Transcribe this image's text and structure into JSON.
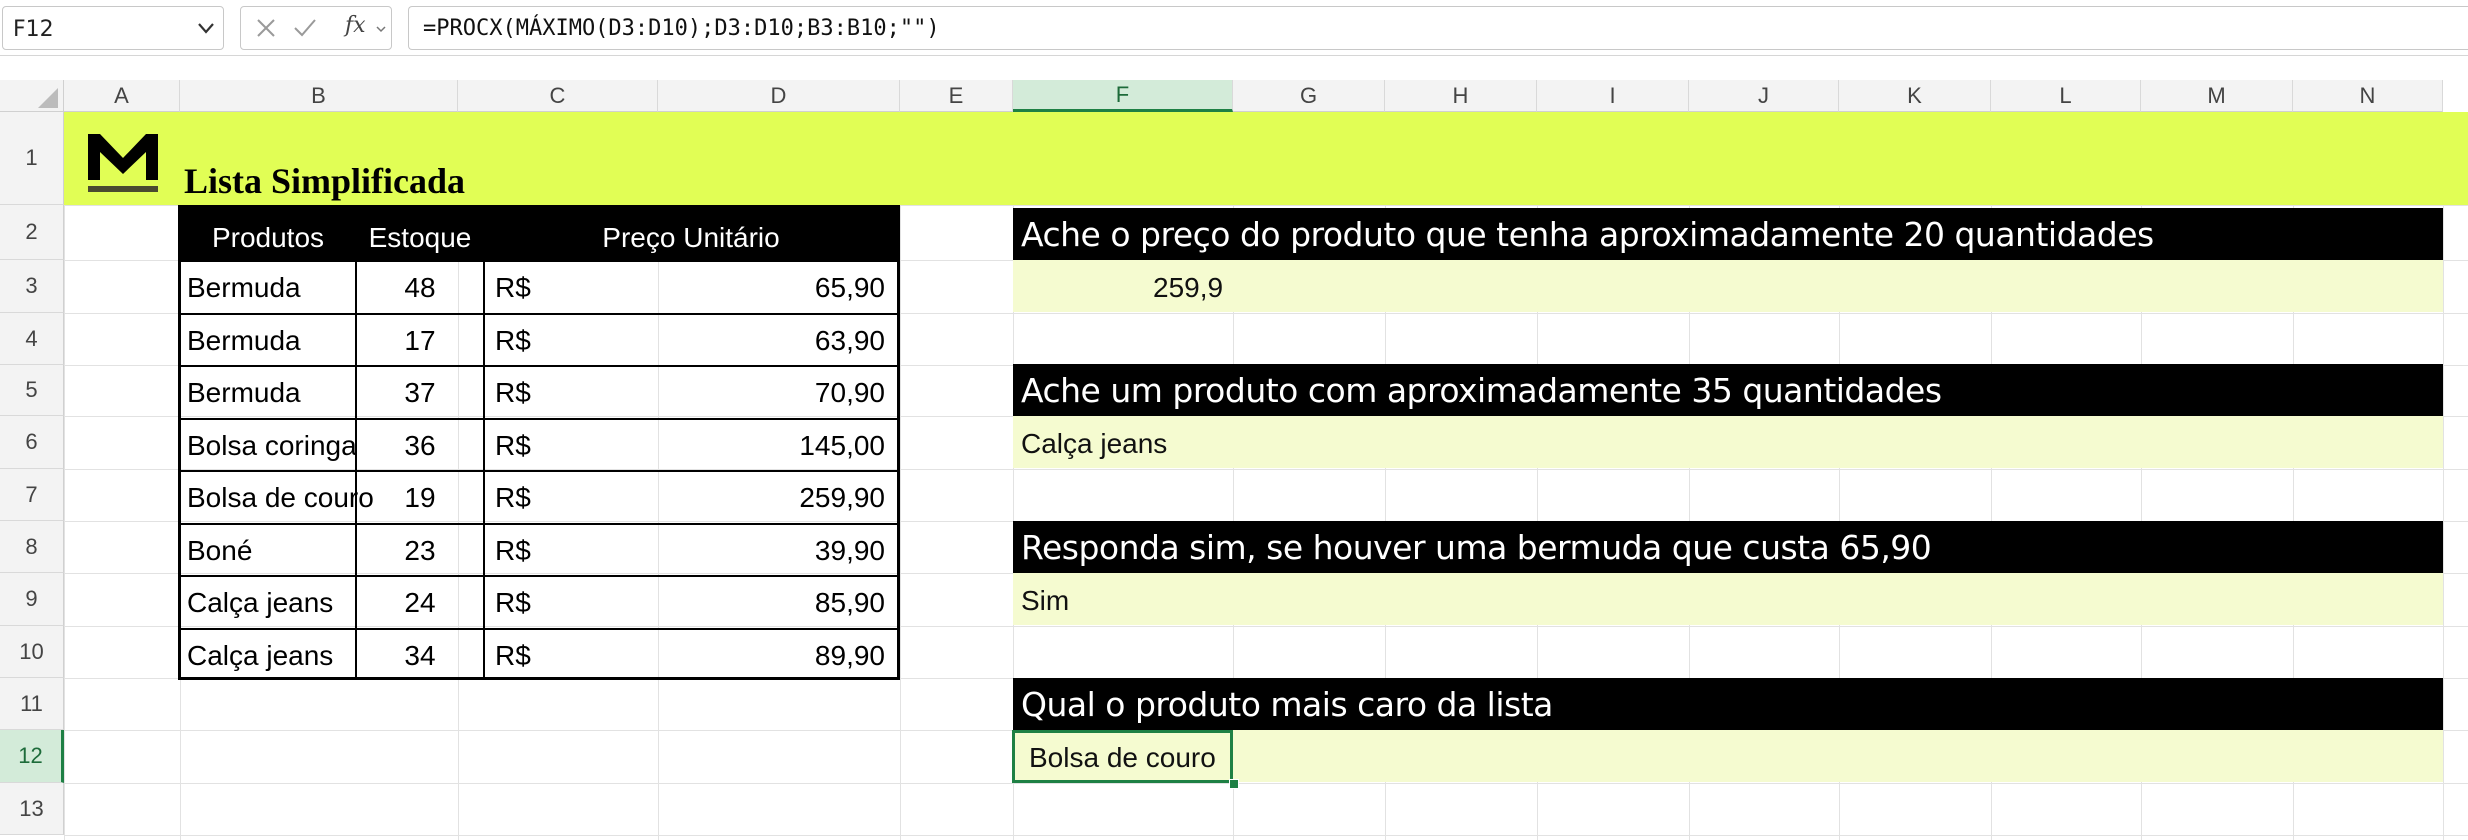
{
  "formula_bar": {
    "name_box": "F12",
    "fx_label": "fx",
    "formula": "=PROCX(MÁXIMO(D3:D10);D3:D10;B3:B10;\"\")"
  },
  "columns": [
    "A",
    "B",
    "C",
    "D",
    "E",
    "F",
    "G",
    "H",
    "I",
    "J",
    "K",
    "L",
    "M",
    "N"
  ],
  "selected_column": "F",
  "rows": [
    "1",
    "2",
    "3",
    "4",
    "5",
    "6",
    "7",
    "8",
    "9",
    "10",
    "11",
    "12",
    "13"
  ],
  "selected_row": "12",
  "sheet": {
    "title": "Lista Simplificada",
    "band_color": "#e1fe55",
    "answer_fill": "#f5fbd0",
    "selection_color": "#1e8044"
  },
  "product_table": {
    "headers": [
      "Produtos",
      "Estoque",
      "Preço Unitário"
    ],
    "currency": "R$",
    "rows": [
      {
        "produto": "Bermuda",
        "estoque": "48",
        "preco": "65,90"
      },
      {
        "produto": "Bermuda",
        "estoque": "17",
        "preco": "63,90"
      },
      {
        "produto": "Bermuda",
        "estoque": "37",
        "preco": "70,90"
      },
      {
        "produto": "Bolsa coringa",
        "estoque": "36",
        "preco": "145,00"
      },
      {
        "produto": "Bolsa de couro",
        "estoque": "19",
        "preco": "259,90"
      },
      {
        "produto": "Boné",
        "estoque": "23",
        "preco": "39,90"
      },
      {
        "produto": "Calça jeans",
        "estoque": "24",
        "preco": "85,90"
      },
      {
        "produto": "Calça jeans",
        "estoque": "34",
        "preco": "89,90"
      }
    ]
  },
  "questions": [
    {
      "question": "Ache o preço do produto que tenha aproximadamente 20 quantidades",
      "answer": "259,9"
    },
    {
      "question": "Ache um produto com aproximadamente 35 quantidades",
      "answer": "Calça jeans"
    },
    {
      "question": "Responda sim, se houver uma bermuda que custa 65,90",
      "answer": "Sim"
    },
    {
      "question": "Qual o produto mais caro da lista",
      "answer": "Bolsa de couro"
    }
  ]
}
